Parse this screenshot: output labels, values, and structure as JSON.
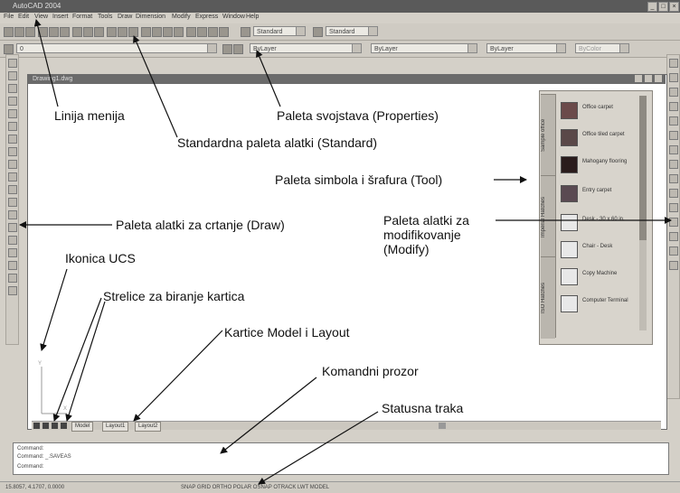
{
  "app": {
    "title": "AutoCAD 2004",
    "menus": [
      "File",
      "Edit",
      "View",
      "Insert",
      "Format",
      "Tools",
      "Draw",
      "Dimension",
      "Modify",
      "Express",
      "Window",
      "Help"
    ]
  },
  "toolbar": {
    "style_dropdown": "Standard",
    "dimstyle_dropdown": "Standard",
    "layer_dropdown": "0",
    "color_dropdown": "ByLayer",
    "linetype_dropdown": "ByLayer",
    "lineweight_dropdown": "ByLayer",
    "plotstyle_dropdown": "ByColor"
  },
  "drawing_window": {
    "title": "Drawing1.dwg",
    "ucs_label": "Y X"
  },
  "tool_palette": {
    "tabs": [
      "Sample office",
      "Imperial Hatches",
      "ISO Hatches"
    ],
    "items": [
      {
        "label": "Office carpet",
        "color": "#6b4a4a"
      },
      {
        "label": "Office tiled carpet",
        "color": "#5a4848"
      },
      {
        "label": "Mahogany flooring",
        "color": "#2a1c1c"
      },
      {
        "label": "Entry carpet",
        "color": "#5a4a52"
      },
      {
        "label": "Desk - 30 x 60 in.",
        "color": "#e8e8e8"
      },
      {
        "label": "Chair - Desk",
        "color": "#e8e8e8"
      },
      {
        "label": "Copy Machine",
        "color": "#e8e8e8"
      },
      {
        "label": "Computer Terminal",
        "color": "#e8e8e8"
      }
    ]
  },
  "tabs": [
    "Model",
    "Layout1",
    "Layout2"
  ],
  "command": {
    "lines": [
      "Command:",
      "Command: _.SAVEAS",
      "Command:"
    ]
  },
  "status": {
    "coords": "15.8057, 4.1707, 0.0000",
    "toggles": "SNAP GRID ORTHO POLAR OSNAP OTRACK LWT MODEL"
  },
  "annotations": {
    "menu_bar": "Linija menija",
    "properties": "Paleta svojstava (Properties)",
    "standard": "Standardna paleta alatki (Standard)",
    "tool": "Paleta simbola i šrafura (Tool)",
    "draw": "Paleta alatki za crtanje (Draw)",
    "modify_1": "Paleta alatki za",
    "modify_2": "modifikovanje",
    "modify_3": "(Modify)",
    "ucs": "Ikonica UCS",
    "tab_arrows": "Strelice za biranje kartica",
    "model_layout": "Kartice Model i Layout",
    "command_window": "Komandni prozor",
    "status_bar": "Statusna traka"
  }
}
